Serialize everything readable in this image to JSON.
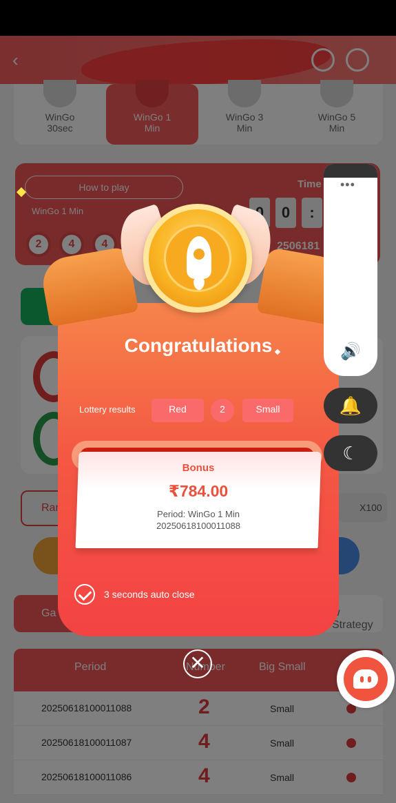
{
  "header": {
    "back_icon": "chevron-left-icon",
    "icons": [
      "support-icon",
      "music-icon"
    ]
  },
  "game_tabs": [
    {
      "label": "WinGo 30sec",
      "line1": "WinGo",
      "line2": "30sec",
      "active": false
    },
    {
      "label": "WinGo 1 Min",
      "line1": "WinGo 1",
      "line2": "Min",
      "active": true
    },
    {
      "label": "WinGo 3 Min",
      "line1": "WinGo 3",
      "line2": "Min",
      "active": false
    },
    {
      "label": "WinGo 5 Min",
      "line1": "WinGo 5",
      "line2": "Min",
      "active": false
    }
  ],
  "draw": {
    "how_to_play": "How to play",
    "game_name": "WinGo 1 Min",
    "last_balls": [
      "2",
      "4",
      "4"
    ],
    "time_label": "Time",
    "timer_digits": [
      "0",
      "0",
      ":"
    ],
    "period_partial": "2506181"
  },
  "bet": {
    "random_label": "Ran",
    "multiplier": "X100"
  },
  "history": {
    "game_history_label": "Ga",
    "my_strategy_label": "w Strategy"
  },
  "table": {
    "headers": {
      "period": "Period",
      "number": "Number",
      "big_small": "Big Small"
    },
    "rows": [
      {
        "period": "20250618100011088",
        "number": "2",
        "size": "Small",
        "color": "#e03b3b"
      },
      {
        "period": "20250618100011087",
        "number": "4",
        "size": "Small",
        "color": "#e03b3b"
      },
      {
        "period": "20250618100011086",
        "number": "4",
        "size": "Small",
        "color": "#e03b3b"
      }
    ]
  },
  "modal": {
    "title": "Congratulations",
    "lottery_label": "Lottery results",
    "result_color": "Red",
    "result_number": "2",
    "result_size": "Small",
    "bonus_label": "Bonus",
    "bonus_amount": "₹784.00",
    "period_line": "Period: WinGo 1 Min",
    "period_id": "20250618100011088",
    "auto_close": "3 seconds auto close",
    "close_icon": "close-icon"
  },
  "side": {
    "menu_dots": "•••",
    "speaker_icon": "speaker-icon",
    "bell_icon": "bell-icon",
    "moon_icon": "moon-icon",
    "chat_icon": "chat-icon"
  },
  "colors": {
    "brand_red": "#f25656",
    "gold": "#f9b422"
  }
}
